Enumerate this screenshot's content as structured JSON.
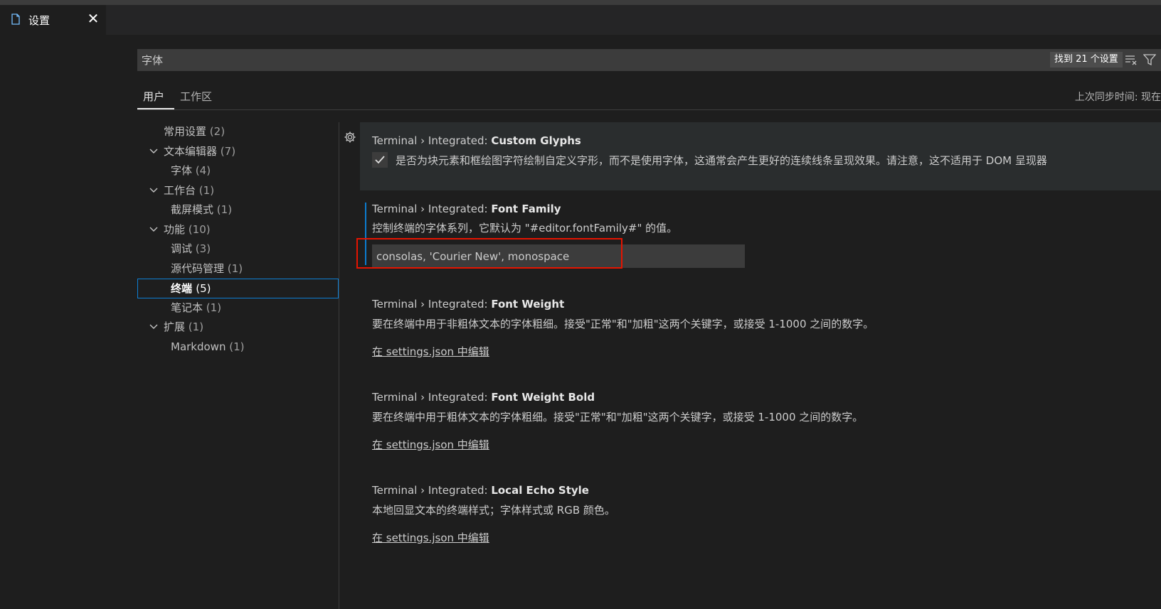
{
  "editor_tab": {
    "icon": "file-icon",
    "label": "设置",
    "close_glyph": "✕"
  },
  "search": {
    "value": "字体",
    "results": "找到 21 个设置",
    "clear_icon": "clear-filter-icon",
    "filter_icon": "filter-icon"
  },
  "scope_tabs": [
    {
      "label": "用户",
      "active": true
    },
    {
      "label": "工作区",
      "active": false
    }
  ],
  "sync_status": "上次同步时间: 现在",
  "toc": [
    {
      "label": "常用设置",
      "count": "(2)",
      "level": 0,
      "chevron": false
    },
    {
      "label": "文本编辑器",
      "count": "(7)",
      "level": 0,
      "chevron": true
    },
    {
      "label": "字体",
      "count": "(4)",
      "level": 1,
      "chevron": false
    },
    {
      "label": "工作台",
      "count": "(1)",
      "level": 0,
      "chevron": true
    },
    {
      "label": "截屏模式",
      "count": "(1)",
      "level": 1,
      "chevron": false
    },
    {
      "label": "功能",
      "count": "(10)",
      "level": 0,
      "chevron": true
    },
    {
      "label": "调试",
      "count": "(3)",
      "level": 1,
      "chevron": false
    },
    {
      "label": "源代码管理",
      "count": "(1)",
      "level": 1,
      "chevron": false
    },
    {
      "label": "终端",
      "count": "(5)",
      "level": 1,
      "chevron": false,
      "selected": true
    },
    {
      "label": "笔记本",
      "count": "(1)",
      "level": 1,
      "chevron": false
    },
    {
      "label": "扩展",
      "count": "(1)",
      "level": 0,
      "chevron": true
    },
    {
      "label": "Markdown",
      "count": "(1)",
      "level": 1,
      "chevron": false
    }
  ],
  "settings": [
    {
      "category": "Terminal › Integrated: ",
      "key": "Custom Glyphs",
      "description": "是否为块元素和框绘图字符绘制自定义字形，而不是使用字体，这通常会产生更好的连续线条呈现效果。请注意，这不适用于 DOM 呈现器",
      "checked": true
    },
    {
      "category": "Terminal › Integrated: ",
      "key": "Font Family",
      "description": "控制终端的字体系列，它默认为 \"#editor.fontFamily#\" 的值。",
      "value": "consolas, 'Courier New', monospace"
    },
    {
      "category": "Terminal › Integrated: ",
      "key": "Font Weight",
      "description": "要在终端中用于非粗体文本的字体粗细。接受\"正常\"和\"加粗\"这两个关键字，或接受 1-1000 之间的数字。",
      "link": "在 settings.json 中编辑"
    },
    {
      "category": "Terminal › Integrated: ",
      "key": "Font Weight Bold",
      "description": "要在终端中用于粗体文本的字体粗细。接受\"正常\"和\"加粗\"这两个关键字，或接受 1-1000 之间的数字。",
      "link": "在 settings.json 中编辑"
    },
    {
      "category": "Terminal › Integrated: ",
      "key": "Local Echo Style",
      "description": "本地回显文本的终端样式；字体样式或 RGB 颜色。",
      "link": "在 settings.json 中编辑"
    }
  ],
  "colors": {
    "background": "#1e1e1e",
    "focus_border": "#0e7fd4",
    "modified_indicator": "#0c7ccf",
    "highlight_box": "#e51400"
  }
}
